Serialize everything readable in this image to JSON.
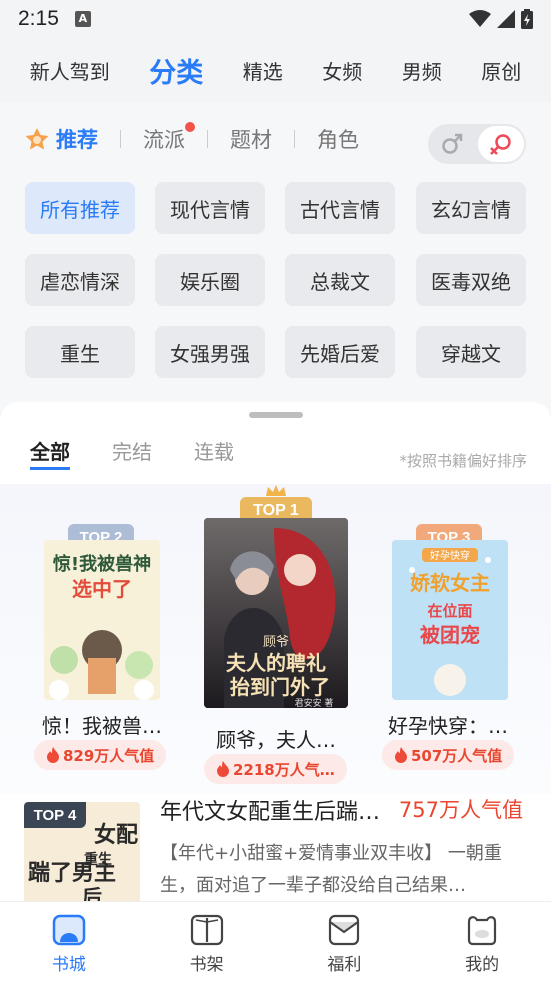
{
  "status_bar": {
    "time": "2:15"
  },
  "top_tabs": [
    {
      "label": "新人驾到"
    },
    {
      "label": "分类"
    },
    {
      "label": "精选"
    },
    {
      "label": "女频"
    },
    {
      "label": "男频"
    },
    {
      "label": "原创"
    }
  ],
  "sub_tabs": [
    {
      "label": "推荐"
    },
    {
      "label": "流派"
    },
    {
      "label": "题材"
    },
    {
      "label": "角色"
    }
  ],
  "categories": [
    {
      "label": "所有推荐"
    },
    {
      "label": "现代言情"
    },
    {
      "label": "古代言情"
    },
    {
      "label": "玄幻言情"
    },
    {
      "label": "虐恋情深"
    },
    {
      "label": "娱乐圈"
    },
    {
      "label": "总裁文"
    },
    {
      "label": "医毒双绝"
    },
    {
      "label": "重生"
    },
    {
      "label": "女强男强"
    },
    {
      "label": "先婚后爱"
    },
    {
      "label": "穿越文"
    }
  ],
  "filter_tabs": [
    {
      "label": "全部"
    },
    {
      "label": "完结"
    },
    {
      "label": "连载"
    }
  ],
  "sort_note": "*按照书籍偏好排序",
  "top_books": [
    {
      "rank": "TOP 1",
      "title": "顾爷，夫人…",
      "popularity": "2218万人气…",
      "cover_text_top": "顾爷",
      "cover_text_main": "夫人的聘礼抬到门外了",
      "cover_author": "君安安 著"
    },
    {
      "rank": "TOP 2",
      "title": "惊！我被兽…",
      "popularity": "829万人气值",
      "cover_text_main": "惊!我被兽神选中了"
    },
    {
      "rank": "TOP 3",
      "title": "好孕快穿：…",
      "popularity": "507万人气值",
      "cover_text_top": "好孕快穿",
      "cover_text_main": "娇软女主在位面被团宠"
    }
  ],
  "list_books": [
    {
      "rank": "TOP 4",
      "title": "年代文女配重生后踹…",
      "popularity": "757万人气值",
      "description": "【年代+小甜蜜+爱情事业双丰收】 一朝重生，面对追了一辈子都没给自己结果…",
      "cover_text_main": "女配重生踹了男主后"
    }
  ],
  "bottom_nav": [
    {
      "label": "书城"
    },
    {
      "label": "书架"
    },
    {
      "label": "福利"
    },
    {
      "label": "我的"
    }
  ]
}
